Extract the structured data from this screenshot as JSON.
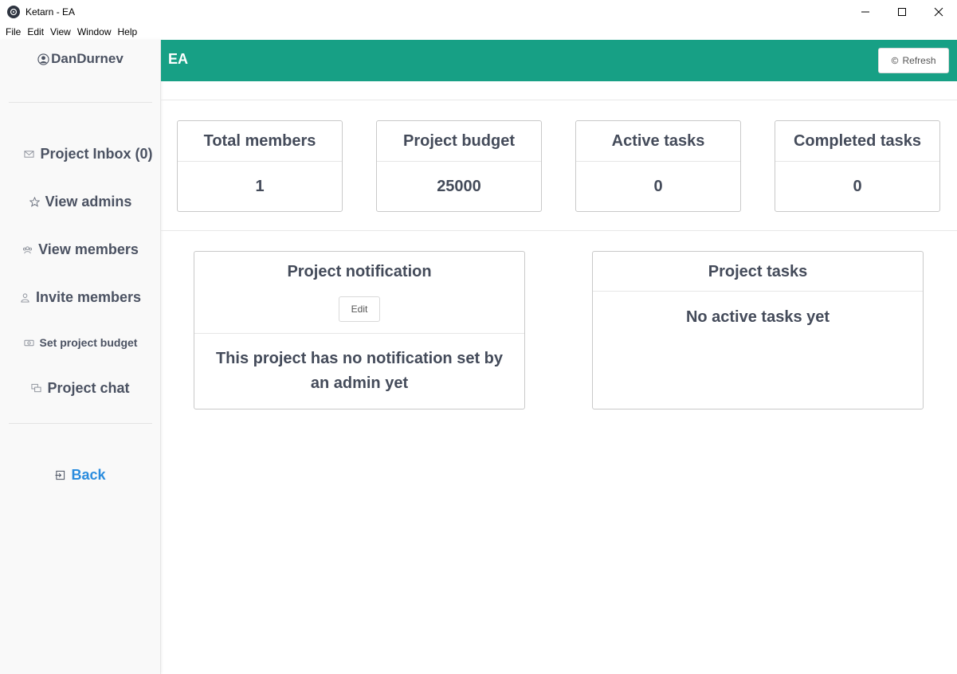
{
  "window": {
    "title": "Ketarn - EA"
  },
  "menu": [
    "File",
    "Edit",
    "View",
    "Window",
    "Help"
  ],
  "sidebar": {
    "username": "DanDurnev",
    "items": [
      {
        "label": "Project Inbox (0)",
        "icon": "envelope-icon"
      },
      {
        "label": "View admins",
        "icon": "star-icon"
      },
      {
        "label": "View members",
        "icon": "group-icon"
      },
      {
        "label": "Invite members",
        "icon": "user-add-icon"
      },
      {
        "label": "Set project budget",
        "icon": "money-icon"
      },
      {
        "label": "Project chat",
        "icon": "chat-icon"
      }
    ],
    "back_label": "Back"
  },
  "header": {
    "title": "EA",
    "refresh_label": "Refresh"
  },
  "stats": [
    {
      "label": "Total members",
      "value": "1"
    },
    {
      "label": "Project budget",
      "value": "25000"
    },
    {
      "label": "Active tasks",
      "value": "0"
    },
    {
      "label": "Completed tasks",
      "value": "0"
    }
  ],
  "notification": {
    "title": "Project notification",
    "edit_label": "Edit",
    "message_line1": "This project has no notification set by",
    "message_line2": "an admin yet"
  },
  "tasks": {
    "title": "Project tasks",
    "message": "No active tasks yet"
  },
  "colors": {
    "header": "#17a085",
    "back_link": "#2a8cde",
    "text": "#444b5a"
  }
}
